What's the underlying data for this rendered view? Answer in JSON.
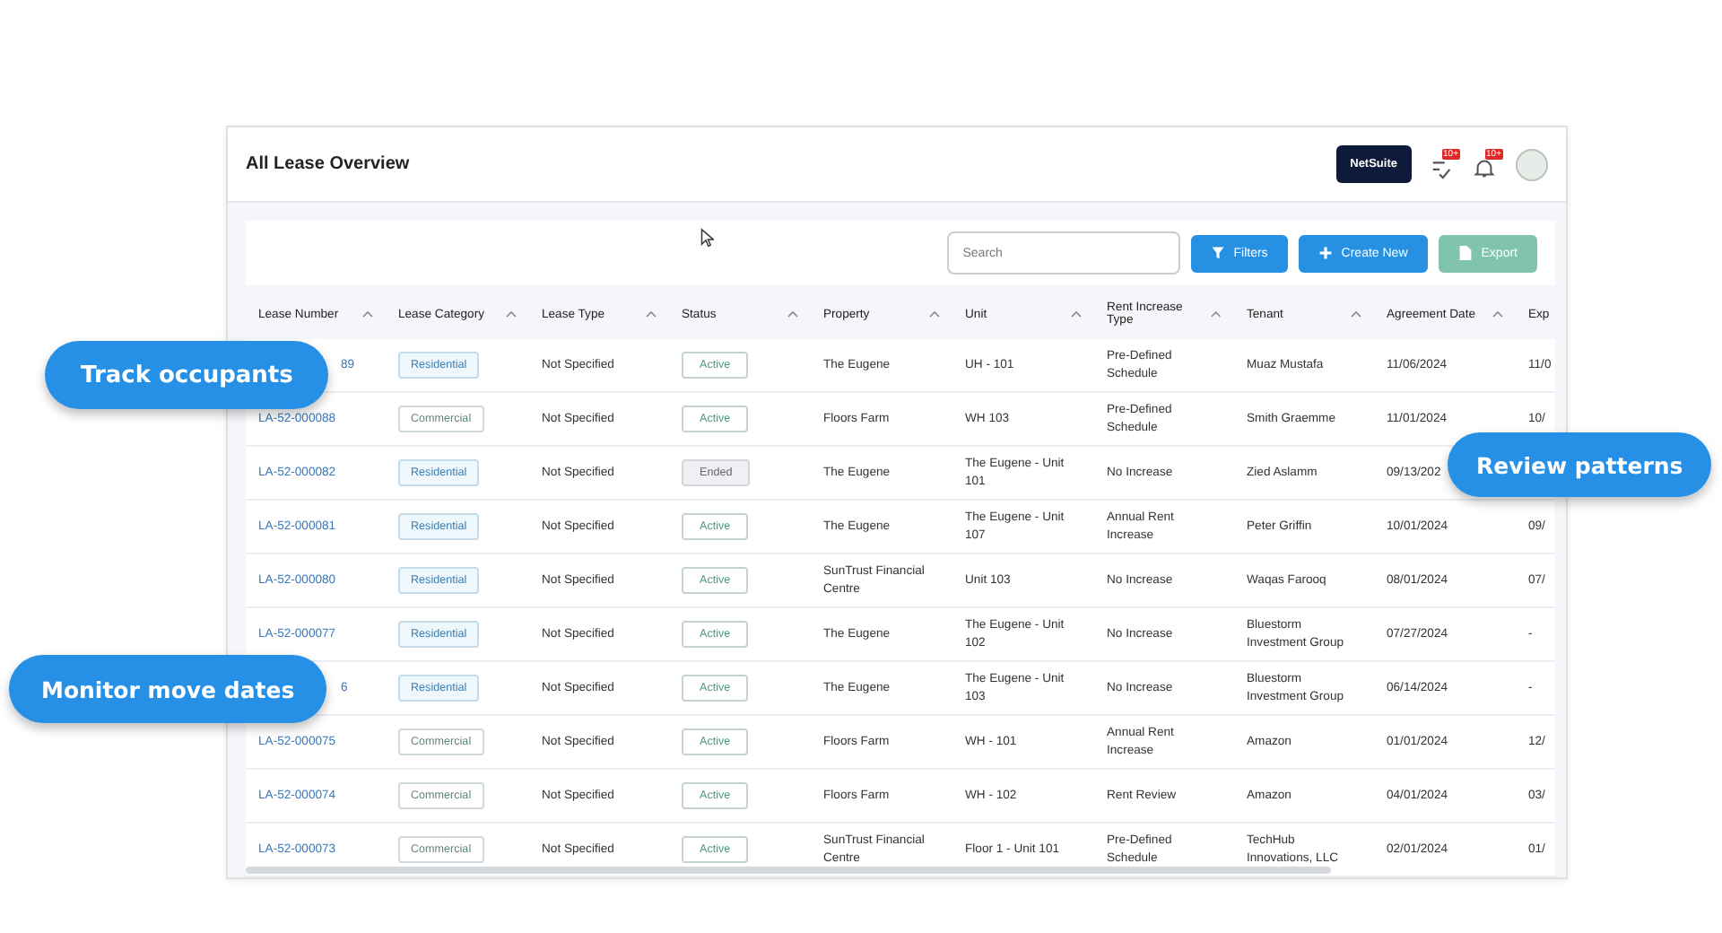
{
  "header": {
    "title": "All Lease Overview",
    "brand_button": "NetSuite",
    "notifications": [
      {
        "badge": "10+"
      },
      {
        "badge": "10+"
      }
    ]
  },
  "toolbar": {
    "search": {
      "placeholder": "Search"
    },
    "buttons": [
      {
        "label": "Filters",
        "kind": "filter",
        "disabled": false
      },
      {
        "label": "Create New",
        "kind": "create",
        "disabled": false
      },
      {
        "label": "Export",
        "kind": "export",
        "disabled": true
      }
    ]
  },
  "table": {
    "columns": [
      "Lease Number",
      "Lease Category",
      "Lease Type",
      "Status",
      "Property",
      "Unit",
      "Rent Increase Type",
      "Tenant",
      "Agreement Date",
      "Exp"
    ],
    "rows": [
      {
        "lease_number": "89",
        "covered": true,
        "category": {
          "text": "Residential",
          "kind": "residential"
        },
        "lease_type": "Not Specified",
        "status": {
          "text": "Active",
          "kind": "active"
        },
        "property": "The Eugene",
        "unit": "UH - 101",
        "rent_increase": "Pre-Defined Schedule",
        "tenant": "Muaz Mustafa",
        "agreement_date": "11/06/2024",
        "column_10": "11/0"
      },
      {
        "lease_number": "LA-52-000088",
        "covered": false,
        "category": {
          "text": "Commercial",
          "kind": "commercial"
        },
        "lease_type": "Not Specified",
        "status": {
          "text": "Active",
          "kind": "active"
        },
        "property": "Floors Farm",
        "unit": "WH 103",
        "rent_increase": "Pre-Defined Schedule",
        "tenant": "Smith Graemme",
        "agreement_date": "11/01/2024",
        "column_10": "10/"
      },
      {
        "lease_number": "LA-52-000082",
        "covered": false,
        "category": {
          "text": "Residential",
          "kind": "residential"
        },
        "lease_type": "Not Specified",
        "status": {
          "text": "Ended",
          "kind": "ended"
        },
        "property": "The Eugene",
        "unit": "The Eugene - Unit 101",
        "rent_increase": "No Increase",
        "tenant": "Zied Aslamm",
        "agreement_date": "09/13/202"
      },
      {
        "lease_number": "LA-52-000081",
        "covered": false,
        "category": {
          "text": "Residential",
          "kind": "residential"
        },
        "lease_type": "Not Specified",
        "status": {
          "text": "Active",
          "kind": "active"
        },
        "property": "The Eugene",
        "unit": "The Eugene - Unit 107",
        "rent_increase": "Annual Rent Increase",
        "tenant": "Peter Griffin",
        "agreement_date": "10/01/2024",
        "column_10": "09/"
      },
      {
        "lease_number": "LA-52-000080",
        "covered": false,
        "category": {
          "text": "Residential",
          "kind": "residential"
        },
        "lease_type": "Not Specified",
        "status": {
          "text": "Active",
          "kind": "active"
        },
        "property": "SunTrust Financial Centre",
        "unit": "Unit 103",
        "rent_increase": "No Increase",
        "tenant": "Waqas Farooq",
        "agreement_date": "08/01/2024",
        "column_10": "07/"
      },
      {
        "lease_number": "LA-52-000077",
        "covered": false,
        "category": {
          "text": "Residential",
          "kind": "residential"
        },
        "lease_type": "Not Specified",
        "status": {
          "text": "Active",
          "kind": "active"
        },
        "property": "The Eugene",
        "unit": "The Eugene - Unit 102",
        "rent_increase": "No Increase",
        "tenant": "Bluestorm Investment Group",
        "agreement_date": "07/27/2024",
        "column_10": "-"
      },
      {
        "lease_number": "6",
        "covered": true,
        "category": {
          "text": "Residential",
          "kind": "residential"
        },
        "lease_type": "Not Specified",
        "status": {
          "text": "Active",
          "kind": "active"
        },
        "property": "The Eugene",
        "unit": "The Eugene - Unit 103",
        "rent_increase": "No Increase",
        "tenant": "Bluestorm Investment Group",
        "agreement_date": "06/14/2024",
        "column_10": "-"
      },
      {
        "lease_number": "LA-52-000075",
        "covered": false,
        "category": {
          "text": "Commercial",
          "kind": "commercial"
        },
        "lease_type": "Not Specified",
        "status": {
          "text": "Active",
          "kind": "active"
        },
        "property": "Floors Farm",
        "unit": "WH - 101",
        "rent_increase": "Annual Rent Increase",
        "tenant": "Amazon",
        "agreement_date": "01/01/2024",
        "column_10": "12/"
      },
      {
        "lease_number": "LA-52-000074",
        "covered": false,
        "category": {
          "text": "Commercial",
          "kind": "commercial"
        },
        "lease_type": "Not Specified",
        "status": {
          "text": "Active",
          "kind": "active"
        },
        "property": "Floors Farm",
        "unit": "WH - 102",
        "rent_increase": "Rent Review",
        "tenant": "Amazon",
        "agreement_date": "04/01/2024",
        "column_10": "03/"
      },
      {
        "lease_number": "LA-52-000073",
        "covered": false,
        "category": {
          "text": "Commercial",
          "kind": "commercial"
        },
        "lease_type": "Not Specified",
        "status": {
          "text": "Active",
          "kind": "active"
        },
        "property": "SunTrust Financial Centre",
        "unit": "Floor 1 - Unit 101",
        "rent_increase": "Pre-Defined Schedule",
        "tenant": "TechHub Innovations, LLC",
        "agreement_date": "02/01/2024",
        "column_10": "01/"
      }
    ]
  },
  "callouts": [
    {
      "text": "Track occupants",
      "kind": "left-top"
    },
    {
      "text": "Review patterns",
      "kind": "right"
    },
    {
      "text": "Monitor move dates",
      "kind": "left-bottom"
    }
  ]
}
